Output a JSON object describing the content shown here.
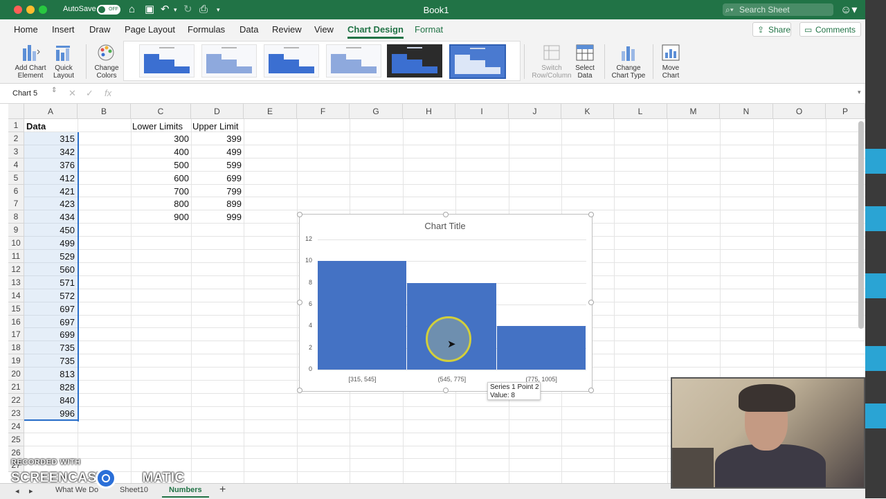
{
  "title_bar": {
    "autosave_label": "AutoSave",
    "autosave_state": "OFF",
    "doc_title": "Book1",
    "search_placeholder": "Search Sheet",
    "accent_color": "#217346"
  },
  "ribbon_tabs": [
    "Home",
    "Insert",
    "Draw",
    "Page Layout",
    "Formulas",
    "Data",
    "Review",
    "View",
    "Chart Design",
    "Format"
  ],
  "active_tab": "Chart Design",
  "share_label": "Share",
  "comments_label": "Comments",
  "ribbon": {
    "add_chart_element": [
      "Add Chart",
      "Element"
    ],
    "quick_layout": [
      "Quick",
      "Layout"
    ],
    "change_colors": [
      "Change",
      "Colors"
    ],
    "switch_row_column": [
      "Switch",
      "Row/Column"
    ],
    "select_data": [
      "Select",
      "Data"
    ],
    "change_chart_type": [
      "Change",
      "Chart Type"
    ],
    "move_chart": [
      "Move",
      "Chart"
    ]
  },
  "formula_bar": {
    "name_box": "Chart 5",
    "fx": "fx",
    "cancel": "✕",
    "enter": "✓"
  },
  "columns": [
    "A",
    "B",
    "C",
    "D",
    "E",
    "F",
    "G",
    "H",
    "I",
    "J",
    "K",
    "L",
    "M",
    "N",
    "O",
    "P"
  ],
  "rows": [
    "1",
    "2",
    "3",
    "4",
    "5",
    "6",
    "7",
    "8",
    "9",
    "10",
    "11",
    "12",
    "13",
    "14",
    "15",
    "16",
    "17",
    "18",
    "19",
    "20",
    "21",
    "22",
    "23",
    "24",
    "25",
    "26",
    "27"
  ],
  "sheet": {
    "a_header": "Data",
    "a_values": [
      "315",
      "342",
      "376",
      "412",
      "421",
      "423",
      "434",
      "450",
      "499",
      "529",
      "560",
      "571",
      "572",
      "697",
      "697",
      "699",
      "735",
      "735",
      "813",
      "828",
      "840",
      "996"
    ],
    "c_header": "Lower Limits",
    "d_header": "Upper Limit",
    "lower_limits": [
      "300",
      "400",
      "500",
      "600",
      "700",
      "800",
      "900"
    ],
    "upper_limits": [
      "399",
      "499",
      "599",
      "699",
      "799",
      "899",
      "999"
    ]
  },
  "chart_data": {
    "type": "bar",
    "title": "Chart Title",
    "categories": [
      "[315, 545]",
      "(545, 775]",
      "(775, 1005]"
    ],
    "values": [
      10,
      8,
      4
    ],
    "ylim": [
      0,
      12
    ],
    "yticks": [
      "0",
      "2",
      "4",
      "6",
      "8",
      "10",
      "12"
    ],
    "grid": true,
    "bar_color": "#4472c4"
  },
  "tooltip": {
    "line1": "Series 1 Point 2",
    "line2": "Value: 8"
  },
  "sheet_tabs": [
    "What We Do",
    "Sheet10",
    "Numbers"
  ],
  "active_sheet": "Numbers",
  "add_sheet": "+",
  "watermark": {
    "line1": "RECORDED WITH",
    "line2_a": "SCREENCAST",
    "line2_b": "MATIC"
  }
}
